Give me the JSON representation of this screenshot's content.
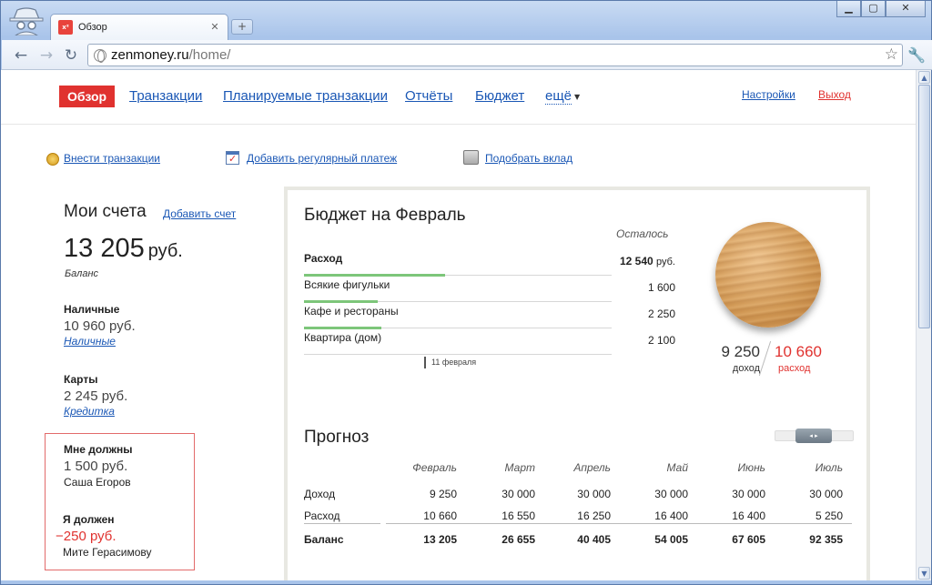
{
  "browser": {
    "tab_title": "Обзор",
    "tab_favicon_text": "x²",
    "url_host": "zenmoney.ru",
    "url_path": "/home/"
  },
  "topnav": {
    "active": "Обзор",
    "links": [
      "Транзакции",
      "Планируемые транзакции",
      "Отчёты",
      "Бюджет",
      "ещё"
    ],
    "settings": "Настройки",
    "logout": "Выход",
    "logout_color": "#e0322f"
  },
  "actions": {
    "add_transaction": "Внести транзакции",
    "add_regular": "Добавить регулярный платеж",
    "pick_deposit": "Подобрать вклад"
  },
  "accounts": {
    "title": "Мои счета",
    "add_link": "Добавить счет",
    "balance_value": "13 205",
    "balance_currency": "руб.",
    "balance_label": "Баланс",
    "cash": {
      "name": "Наличные",
      "value": "10 960 руб.",
      "link": "Наличные"
    },
    "cards": {
      "name": "Карты",
      "value": "2 245 руб.",
      "link": "Кредитка"
    },
    "owed_to_me": {
      "name": "Мне должны",
      "value": "1 500 руб.",
      "person": "Саша Егоров"
    },
    "i_owe": {
      "name": "Я должен",
      "value": "−250 руб.",
      "person": "Мите Герасимову"
    }
  },
  "budget": {
    "title": "Бюджет на Февраль",
    "remain_header": "Осталось",
    "rows": [
      {
        "name": "Расход",
        "amount": "12 540",
        "currency": "руб.",
        "progress": 0.46,
        "bold": true
      },
      {
        "name": "Всякие фигульки",
        "amount": "1 600",
        "progress": 0.24
      },
      {
        "name": "Кафе и рестораны",
        "amount": "2 250",
        "progress": 0.25
      },
      {
        "name": "Квартира (дом)",
        "amount": "2 100",
        "progress": 0
      }
    ],
    "date_marker": "11 февраля",
    "income_value": "9 250",
    "income_label": "доход",
    "expense_value": "10 660",
    "expense_label": "расход",
    "accent_green": "#7dc67a"
  },
  "forecast": {
    "title": "Прогноз",
    "months": [
      "Февраль",
      "Март",
      "Апрель",
      "Май",
      "Июнь",
      "Июль"
    ],
    "rows": [
      {
        "label": "Доход",
        "values": [
          "9 250",
          "30 000",
          "30 000",
          "30 000",
          "30 000",
          "30 000"
        ]
      },
      {
        "label": "Расход",
        "values": [
          "10 660",
          "16 550",
          "16 250",
          "16 400",
          "16 400",
          "5 250"
        ]
      },
      {
        "label": "Баланс",
        "values": [
          "13 205",
          "26 655",
          "40 405",
          "54 005",
          "67 605",
          "92 355"
        ]
      }
    ]
  }
}
